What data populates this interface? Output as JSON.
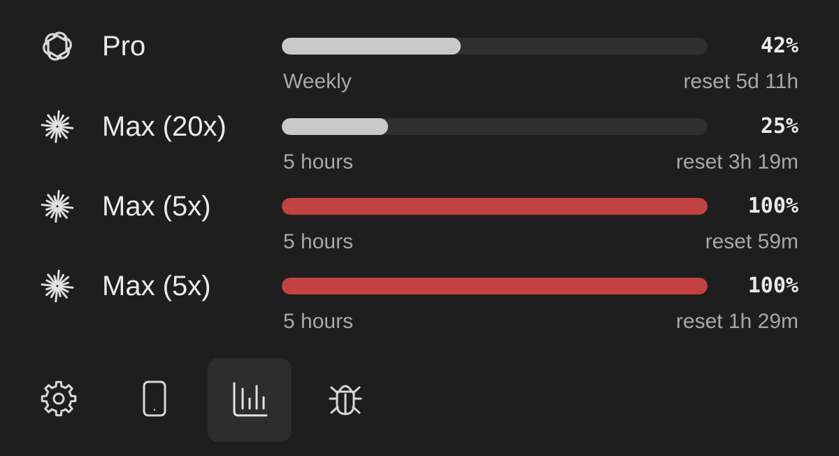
{
  "colors": {
    "background": "#1e1e1e",
    "bar_track": "#2f2f2f",
    "bar_normal": "#c9c9c9",
    "bar_full": "#c24141",
    "text_primary": "#eaeaea",
    "text_secondary": "#a8a8a8"
  },
  "plans": [
    {
      "icon": "openai-logo-icon",
      "name": "Pro",
      "percent": "42%",
      "usage": 0.42,
      "window": "Weekly",
      "reset": "reset 5d 11h"
    },
    {
      "icon": "claude-starburst-icon",
      "name": "Max (20x)",
      "percent": "25%",
      "usage": 0.25,
      "window": "5 hours",
      "reset": "reset 3h 19m"
    },
    {
      "icon": "claude-starburst-icon",
      "name": "Max (5x)",
      "percent": "100%",
      "usage": 1.0,
      "window": "5 hours",
      "reset": "reset 59m"
    },
    {
      "icon": "claude-starburst-icon",
      "name": "Max (5x)",
      "percent": "100%",
      "usage": 1.0,
      "window": "5 hours",
      "reset": "reset 1h 29m"
    }
  ],
  "toolbar": {
    "items": [
      {
        "icon": "gear-icon",
        "active": false
      },
      {
        "icon": "phone-icon",
        "active": false
      },
      {
        "icon": "bar-chart-icon",
        "active": true
      },
      {
        "icon": "bug-icon",
        "active": false
      }
    ]
  }
}
